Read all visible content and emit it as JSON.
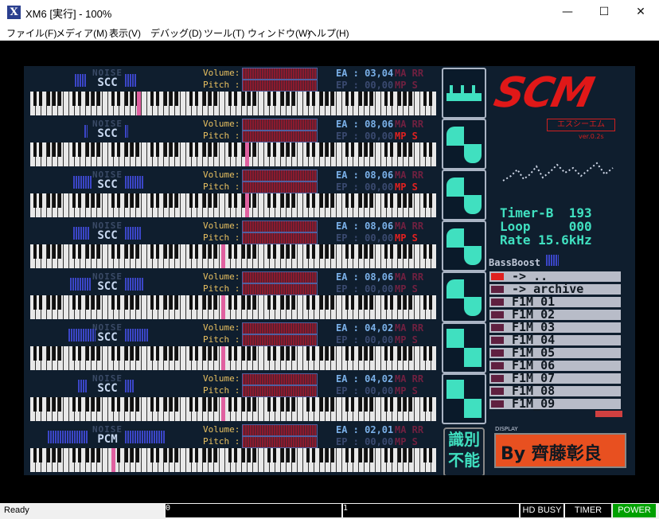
{
  "window": {
    "title": "XM6 [実行] - 100%",
    "app_icon": "X",
    "minimize": "—",
    "maximize": "☐",
    "close": "✕"
  },
  "menu": [
    "ファイル(F)",
    "メディア(M)",
    "表示(V)",
    "デバッグ(D)",
    "ツール(T)",
    "ウィンドウ(W)",
    "ヘルプ(H)"
  ],
  "channels": [
    {
      "noise": "NOISE",
      "chip": "SCC",
      "ea": "EA : 03,04",
      "ep": "EP : 00,00",
      "ma": "MA RR",
      "mp": "MP S",
      "mp_active": false
    },
    {
      "noise": "NOISE",
      "chip": "SCC",
      "ea": "EA : 08,06",
      "ep": "EP : 00,00",
      "ma": "MA RR",
      "mp": "MP S",
      "mp_active": true
    },
    {
      "noise": "NOISE",
      "chip": "SCC",
      "ea": "EA : 08,06",
      "ep": "EP : 00,00",
      "ma": "MA RR",
      "mp": "MP S",
      "mp_active": true
    },
    {
      "noise": "NOISE",
      "chip": "SCC",
      "ea": "EA : 08,06",
      "ep": "EP : 00,00",
      "ma": "MA RR",
      "mp": "MP S",
      "mp_active": true
    },
    {
      "noise": "NOISE",
      "chip": "SCC",
      "ea": "EA : 08,06",
      "ep": "EP : 00,00",
      "ma": "MA RR",
      "mp": "MP S",
      "mp_active": false
    },
    {
      "noise": "NOISE",
      "chip": "SCC",
      "ea": "EA : 04,02",
      "ep": "EP : 00,00",
      "ma": "MA RR",
      "mp": "MP S",
      "mp_active": false
    },
    {
      "noise": "NOISE",
      "chip": "SCC",
      "ea": "EA : 04,02",
      "ep": "EP : 00,00",
      "ma": "MA RR",
      "mp": "MP S",
      "mp_active": false
    },
    {
      "noise": "NOISE",
      "chip": "PCM",
      "ea": "EA : 02,01",
      "ep": "EP : 00,00",
      "ma": "MA RR",
      "mp": "MP S",
      "mp_active": false
    }
  ],
  "labels": {
    "volume": "Volume:",
    "pitch": "Pitch :"
  },
  "logo": {
    "text": "SCM",
    "sub": "エスシーエム",
    "ver": "ver.0.2s"
  },
  "stats": {
    "timer": "Timer-B  193",
    "loop": "Loop     000",
    "rate": "Rate 15.6kHz"
  },
  "bassboost": "BassBoost",
  "files": [
    "-> ..",
    "-> archive",
    "F1M_01",
    "F1M_02",
    "F1M_03",
    "F1M_04",
    "F1M_05",
    "F1M_06",
    "F1M_07",
    "F1M_08",
    "F1M_09"
  ],
  "unknown": "識別不能",
  "display_tag": "DISPLAY",
  "author": "By 齊藤彰良",
  "status": {
    "ready": "Ready",
    "box1": "0",
    "box2": "1",
    "hd": "HD BUSY",
    "timer": "TIMER",
    "power": "POWER"
  },
  "colors": {
    "power_bg": "#00a000",
    "accent_teal": "#40e0c0",
    "logo_red": "#e01818"
  }
}
